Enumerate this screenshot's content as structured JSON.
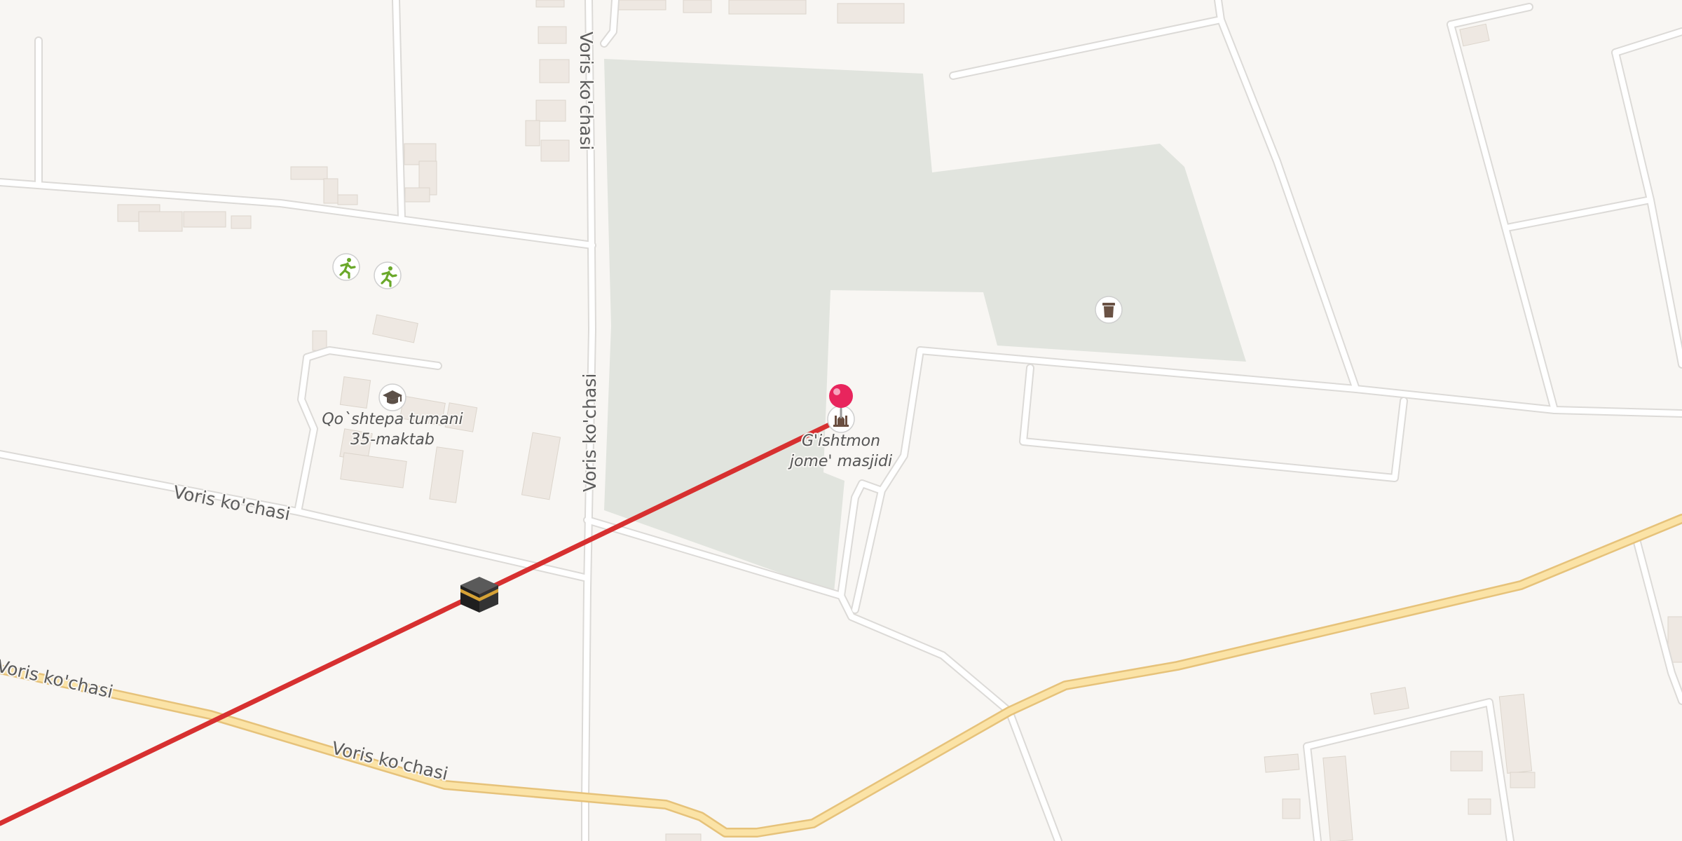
{
  "map": {
    "streets": [
      {
        "name": "Voris ko'chasi"
      },
      {
        "name": "Voris ko'chasi"
      },
      {
        "name": "Voris ko'chasi"
      },
      {
        "name": "Voris ko'chasi"
      },
      {
        "name": "Voris ko'chasi"
      }
    ],
    "pois": [
      {
        "type": "mosque",
        "icon": "mosque-icon",
        "line1": "G'ishtmon",
        "line2": "jome' masjidi",
        "selected": true
      },
      {
        "type": "school",
        "icon": "graduation-cap-icon",
        "line1": "Qo`shtepa tumani",
        "line2": "35-maktab"
      },
      {
        "type": "sports",
        "icon": "running-icon"
      },
      {
        "type": "sports",
        "icon": "running-icon"
      },
      {
        "type": "cemetery",
        "icon": "tombstone-icon"
      },
      {
        "type": "qibla",
        "icon": "kaaba-icon"
      }
    ],
    "colors": {
      "background": "#f8f6f3",
      "road": "#ffffff",
      "road_outline": "#dcdad7",
      "major_road": "#fbe3a6",
      "major_road_outline": "#e6c27a",
      "green_area": "#e1e4de",
      "building": "#eee8e2",
      "qibla_line": "#d73030",
      "pin": "#e8255d"
    }
  }
}
